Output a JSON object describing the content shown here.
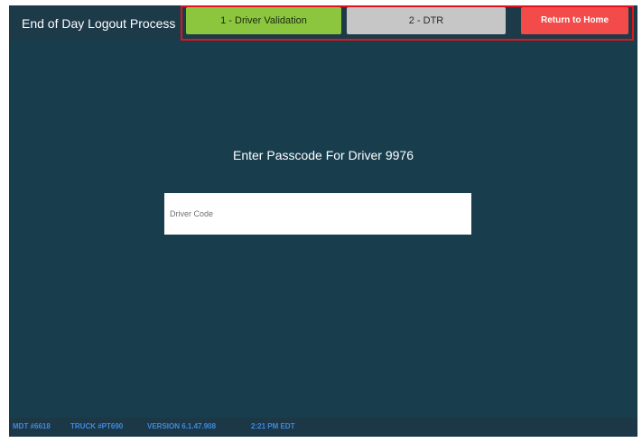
{
  "header": {
    "title": "End of Day Logout Process",
    "steps": [
      {
        "label": "1 - Driver Validation",
        "state": "active",
        "color": "#8cc63e"
      },
      {
        "label": "2 - DTR",
        "state": "inactive",
        "color": "#c6c6c6"
      }
    ],
    "home_button": {
      "label": "Return to Home",
      "color": "#f34a4a"
    }
  },
  "main": {
    "prompt": "Enter Passcode For Driver 9976",
    "driver_code": {
      "placeholder": "Driver Code",
      "value": ""
    }
  },
  "status_bar": {
    "mdt": "MDT #6618",
    "truck": "TRUCK #PT690",
    "version": "VERSION 6.1.47.908",
    "time": "2:21 PM EDT",
    "color": "#3f8ae0"
  },
  "colors": {
    "header_bg": "#1d3a49",
    "content_bg": "#183e4e",
    "highlight_border": "#e0141c"
  }
}
